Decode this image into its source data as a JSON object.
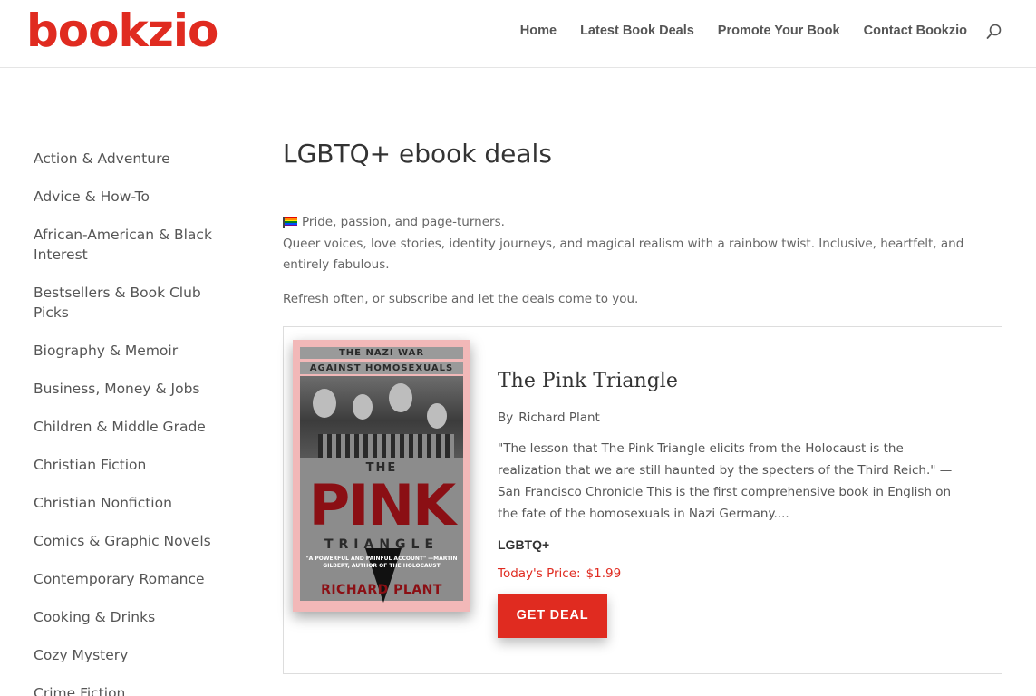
{
  "header": {
    "logo": "bookzio",
    "nav": [
      "Home",
      "Latest Book Deals",
      "Promote Your Book",
      "Contact Bookzio"
    ],
    "search_icon": "search-icon"
  },
  "sidebar": {
    "items": [
      "Action & Adventure",
      "Advice & How-To",
      "African-American & Black Interest",
      "Bestsellers & Book Club Picks",
      "Biography & Memoir",
      "Business, Money & Jobs",
      "Children & Middle Grade",
      "Christian Fiction",
      "Christian Nonfiction",
      "Comics & Graphic Novels",
      "Contemporary Romance",
      "Cooking & Drinks",
      "Cozy Mystery",
      "Crime Fiction"
    ]
  },
  "main": {
    "title": "LGBTQ+ ebook deals",
    "intro_line1": "Pride, passion, and page-turners.",
    "intro_line2": "Queer voices, love stories, identity journeys, and magical realism with a rainbow twist. Inclusive, heartfelt, and entirely fabulous.",
    "intro_refresh": "Refresh often, or subscribe and let the deals come to you.",
    "flag_icon": "rainbow-flag-icon"
  },
  "book": {
    "title": "The Pink Triangle",
    "by_label": "By",
    "author": "Richard Plant",
    "description": "\"The lesson that The Pink Triangle elicits from the Holocaust is the realization that we are still haunted by the specters of the Third Reich.\" — San Francisco Chronicle This is the first comprehensive book in English on the fate of the homosexuals in Nazi Germany....",
    "genre": "LGBTQ+",
    "price_label": "Today's Price:",
    "price": "$1.99",
    "button_label": "GET DEAL",
    "cover": {
      "top_line1": "THE NAZI WAR",
      "top_line2": "AGAINST HOMOSEXUALS",
      "the": "THE",
      "pink": "PINK",
      "triangle": "TRIANGLE",
      "quote": "\"A POWERFUL AND PAINFUL ACCOUNT\" —MARTIN GILBERT, AUTHOR OF THE HOLOCAUST",
      "author": "RICHARD PLANT"
    }
  },
  "colors": {
    "brand": "#e02b20",
    "flag": [
      "#e40303",
      "#ff8c00",
      "#ffed00",
      "#008026",
      "#004dff",
      "#750787"
    ]
  }
}
